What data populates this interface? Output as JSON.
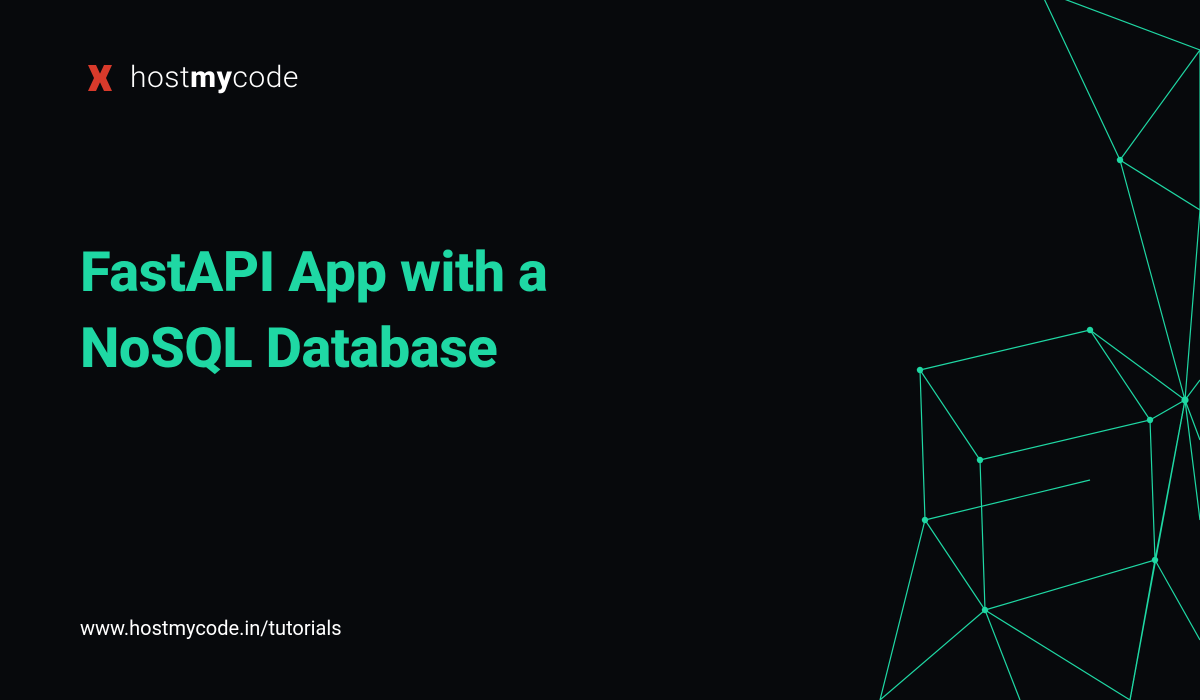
{
  "logo": {
    "text_host": "host",
    "text_my": "my",
    "text_code": "code"
  },
  "headline": {
    "line1": "FastAPI App with a",
    "line2": "NoSQL Database"
  },
  "footer": {
    "url": "www.hostmycode.in/tutorials"
  },
  "colors": {
    "accent_teal": "#1fd8a4",
    "brand_red": "#d83a2b",
    "background": "#07090c",
    "text_white": "#ffffff"
  }
}
